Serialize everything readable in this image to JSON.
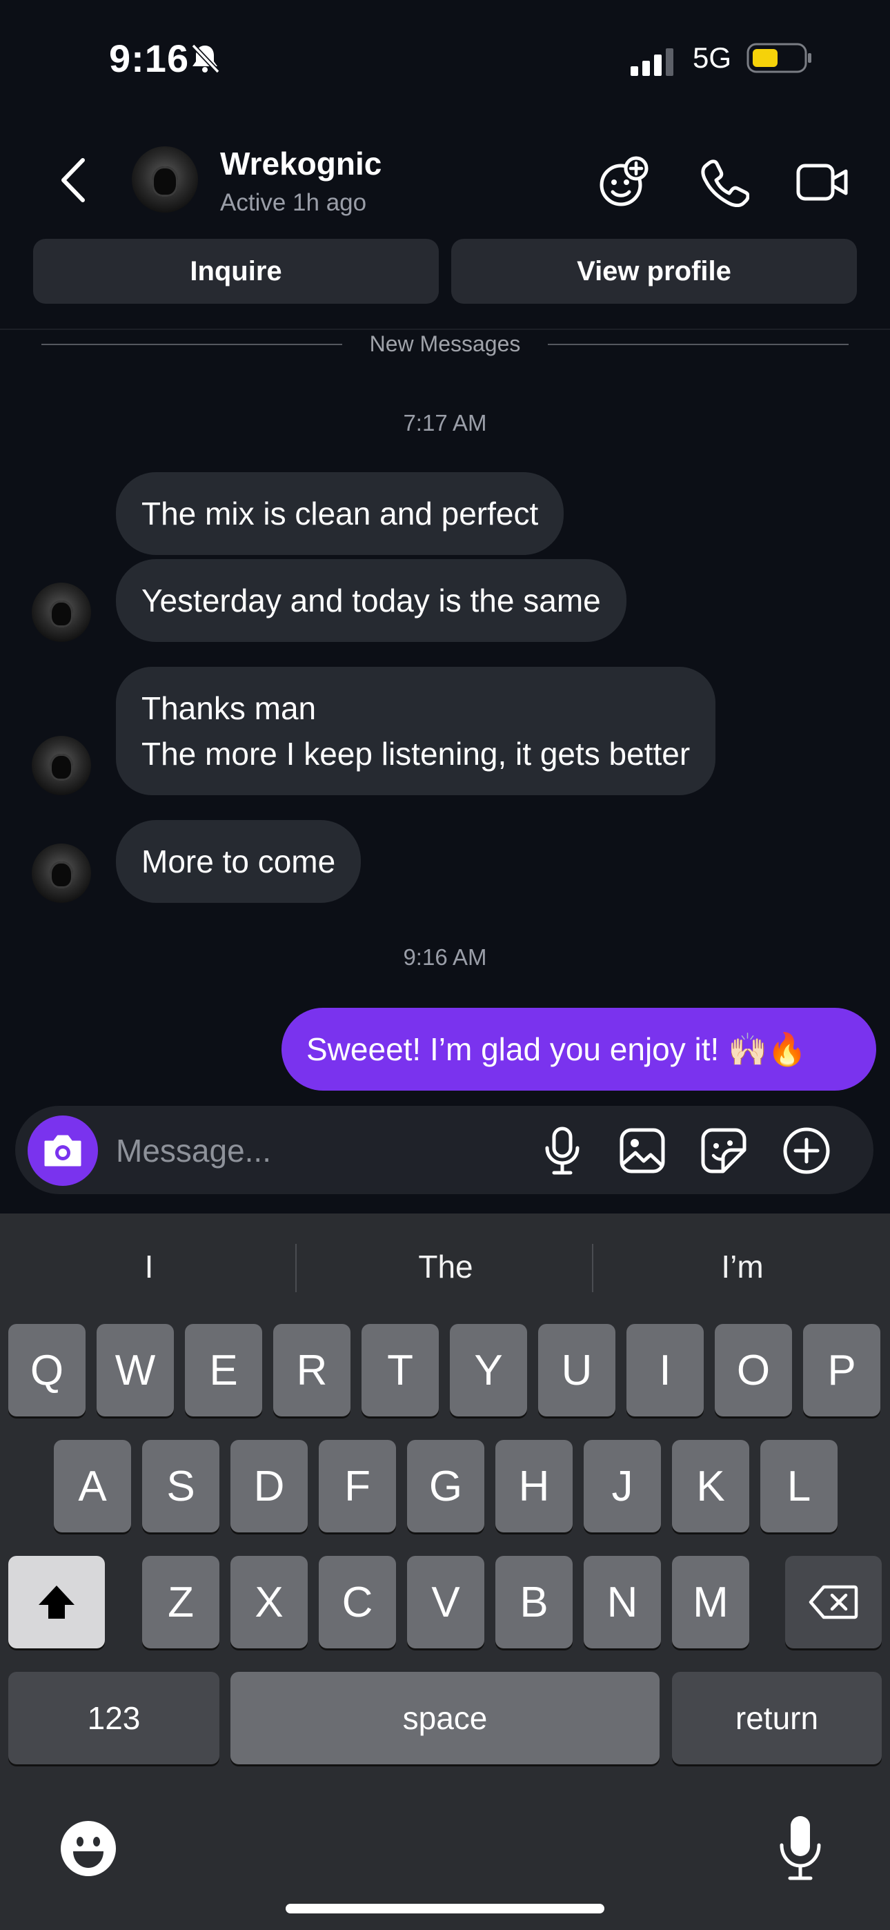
{
  "status_bar": {
    "time": "9:16",
    "network": "5G"
  },
  "header": {
    "name": "Wrekognic",
    "status": "Active 1h ago",
    "inquire_label": "Inquire",
    "view_profile_label": "View profile",
    "icons": [
      "back-chevron-icon",
      "emoji-add-icon",
      "phone-icon",
      "video-camera-icon"
    ]
  },
  "conversation": {
    "new_messages_label": "New Messages",
    "time_1": "7:17 AM",
    "incoming": [
      "The mix is clean and perfect",
      "Yesterday and today is the same",
      "Thanks man",
      "The more I keep listening, it gets better",
      "More to come"
    ],
    "time_2": "9:16 AM",
    "outgoing": "Sweeet! I’m glad you enjoy it! 🙌🏻🔥"
  },
  "composer": {
    "placeholder": "Message...",
    "icons": [
      "camera-icon",
      "microphone-icon",
      "gallery-icon",
      "sticker-icon",
      "plus-circle-icon"
    ]
  },
  "keyboard": {
    "suggestions": [
      "I",
      "The",
      "I’m"
    ],
    "row1": [
      "Q",
      "W",
      "E",
      "R",
      "T",
      "Y",
      "U",
      "I",
      "O",
      "P"
    ],
    "row2": [
      "A",
      "S",
      "D",
      "F",
      "G",
      "H",
      "J",
      "K",
      "L"
    ],
    "row3": [
      "Z",
      "X",
      "C",
      "V",
      "B",
      "N",
      "M"
    ],
    "numbers_label": "123",
    "space_label": "space",
    "return_label": "return"
  },
  "colors": {
    "background": "#0c0f16",
    "bubble_in": "#262a31",
    "bubble_out": "#7a33ee",
    "keyboard": "#2b2d31"
  }
}
